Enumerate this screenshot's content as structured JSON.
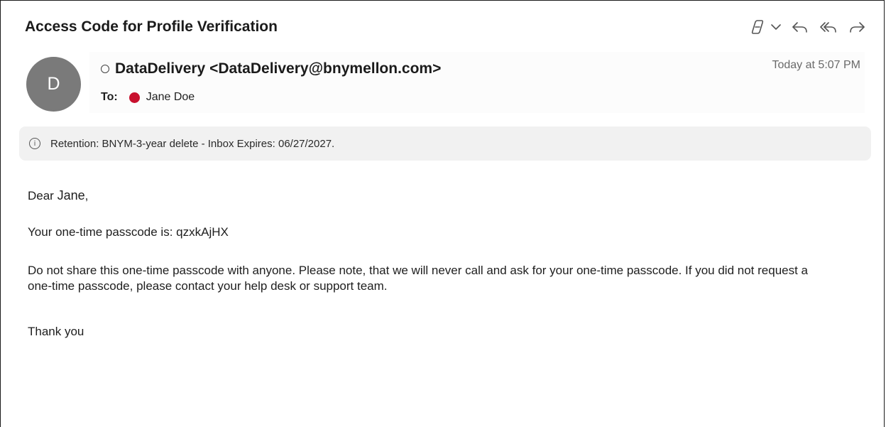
{
  "email": {
    "subject": "Access Code for Profile Verification",
    "avatar_initial": "D",
    "sender": "DataDelivery <DataDelivery@bnymellon.com>",
    "timestamp": "Today at 5:07 PM",
    "to_label": "To:",
    "recipient": "Jane Doe",
    "recipient_status_color": "#c8102e"
  },
  "banner": {
    "text": "Retention: BNYM-3-year delete - Inbox Expires: 06/27/2027."
  },
  "body": {
    "greeting_prefix": "Dear ",
    "greeting_name": "Jane",
    "greeting_suffix": ",",
    "otp_line": "Your one-time passcode is: qzxkAjHX",
    "warning": "Do not share this one-time passcode with anyone. Please note, that we will never call and ask for your one-time passcode. If you did not request a one-time passcode, please contact your help desk or support team.",
    "closing": "Thank you"
  },
  "toolbar": {
    "icons": [
      "copilot-icon",
      "chevron-down-icon",
      "reply-icon",
      "reply-all-icon",
      "forward-icon"
    ]
  }
}
